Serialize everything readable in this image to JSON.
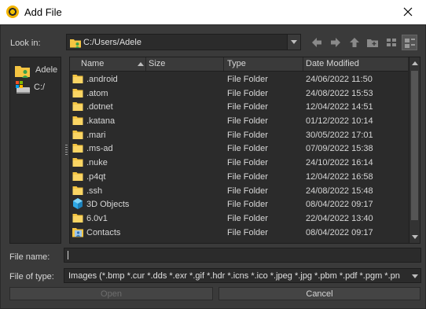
{
  "window": {
    "title": "Add File"
  },
  "lookin": {
    "label": "Look in:",
    "path": "C:/Users/Adele"
  },
  "sidebar": {
    "items": [
      {
        "label": "Adele",
        "icon": "user-folder-icon"
      },
      {
        "label": "C:/",
        "icon": "drive-icon"
      }
    ]
  },
  "columns": {
    "name": "Name",
    "size": "Size",
    "type": "Type",
    "date": "Date Modified"
  },
  "files": [
    {
      "name": ".android",
      "type": "File Folder",
      "date": "24/06/2022 11:50",
      "icon": "folder-icon"
    },
    {
      "name": ".atom",
      "type": "File Folder",
      "date": "24/08/2022 15:53",
      "icon": "folder-icon"
    },
    {
      "name": ".dotnet",
      "type": "File Folder",
      "date": "12/04/2022 14:51",
      "icon": "folder-icon"
    },
    {
      "name": ".katana",
      "type": "File Folder",
      "date": "01/12/2022 10:14",
      "icon": "folder-icon"
    },
    {
      "name": ".mari",
      "type": "File Folder",
      "date": "30/05/2022 17:01",
      "icon": "folder-icon"
    },
    {
      "name": ".ms-ad",
      "type": "File Folder",
      "date": "07/09/2022 15:38",
      "icon": "folder-icon"
    },
    {
      "name": ".nuke",
      "type": "File Folder",
      "date": "24/10/2022 16:14",
      "icon": "folder-icon"
    },
    {
      "name": ".p4qt",
      "type": "File Folder",
      "date": "12/04/2022 16:58",
      "icon": "folder-icon"
    },
    {
      "name": ".ssh",
      "type": "File Folder",
      "date": "24/08/2022 15:48",
      "icon": "folder-icon"
    },
    {
      "name": "3D Objects",
      "type": "File Folder",
      "date": "08/04/2022 09:17",
      "icon": "3d-objects-icon"
    },
    {
      "name": "6.0v1",
      "type": "File Folder",
      "date": "22/04/2022 13:40",
      "icon": "folder-icon"
    },
    {
      "name": "Contacts",
      "type": "File Folder",
      "date": "08/04/2022 09:17",
      "icon": "contacts-icon"
    }
  ],
  "filename": {
    "label": "File name:",
    "value": ""
  },
  "filetype": {
    "label": "File of type:",
    "value": "Images (*.bmp *.cur *.dds *.exr *.gif *.hdr *.icns *.ico *.jpeg *.jpg *.pbm *.pdf *.pgm *.pn"
  },
  "buttons": {
    "open": "Open",
    "cancel": "Cancel"
  },
  "colors": {
    "panel": "#3a3a3a",
    "field": "#2b2b2b",
    "folder": "#f5c542",
    "text": "#d6d6d6"
  }
}
